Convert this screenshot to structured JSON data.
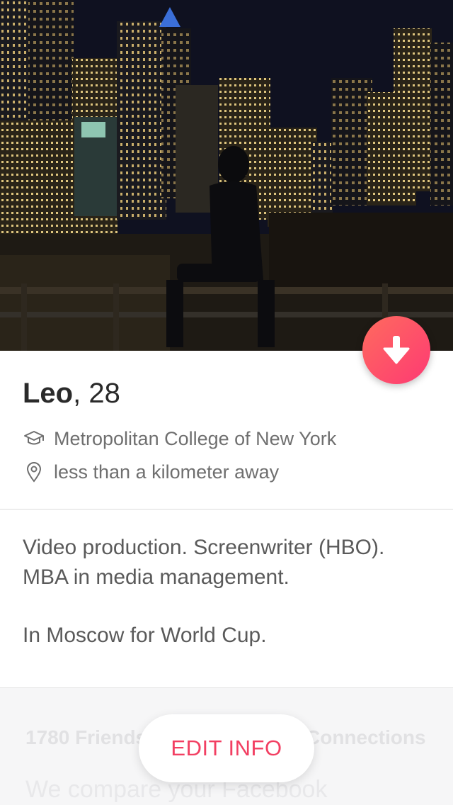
{
  "profile": {
    "name": "Leo",
    "age_text": ", 28",
    "school": "Metropolitan College of New York",
    "distance": "less than a kilometer away",
    "bio_lines": [
      "Video production. Screenwriter (HBO).",
      "MBA in media management.",
      "In Moscow for World Cup."
    ]
  },
  "photo": {
    "description_icon": "profile-photo-night-city"
  },
  "collapse_button": {
    "icon": "arrow-down-icon",
    "color_start": "#ff6b5e",
    "color_end": "#fd3a73"
  },
  "bottom": {
    "friends_text": "1780 Friends",
    "connections_text": "Connections",
    "compare_text": "We compare your Facebook"
  },
  "edit_button": {
    "label": "EDIT INFO",
    "color": "#f23f62"
  },
  "icons": {
    "school": "graduation-cap-icon",
    "distance": "location-pin-icon"
  }
}
